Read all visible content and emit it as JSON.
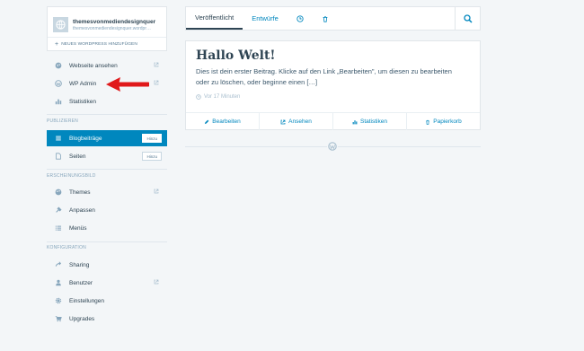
{
  "site": {
    "title": "themesvonmediendesignquer",
    "url": "themesvonmediendesignquer.wordpr…",
    "add_label": "NEUES WORDPRESS HINZUFÜGEN"
  },
  "sidebar": {
    "top_items": [
      {
        "label": "Webseite ansehen",
        "icon": "globe-icon",
        "external": true
      },
      {
        "label": "WP Admin",
        "icon": "wordpress-icon",
        "external": true
      },
      {
        "label": "Statistiken",
        "icon": "stats-icon",
        "external": false
      }
    ],
    "sections": [
      {
        "label": "PUBLIZIEREN",
        "items": [
          {
            "label": "Blogbeiträge",
            "icon": "posts-icon",
            "active": true,
            "add": "Hinzu"
          },
          {
            "label": "Seiten",
            "icon": "pages-icon",
            "active": false,
            "add": "Hinzu"
          }
        ]
      },
      {
        "label": "ERSCHEINUNGSBILD",
        "items": [
          {
            "label": "Themes",
            "icon": "themes-icon",
            "external": true
          },
          {
            "label": "Anpassen",
            "icon": "customize-icon"
          },
          {
            "label": "Menüs",
            "icon": "menus-icon"
          }
        ]
      },
      {
        "label": "KONFIGURATION",
        "items": [
          {
            "label": "Sharing",
            "icon": "share-icon"
          },
          {
            "label": "Benutzer",
            "icon": "user-icon",
            "external": true
          },
          {
            "label": "Einstellungen",
            "icon": "gear-icon"
          },
          {
            "label": "Upgrades",
            "icon": "cart-icon"
          }
        ]
      }
    ]
  },
  "tabs": {
    "published": "Veröffentlicht",
    "drafts": "Entwürfe",
    "scheduled_icon": "clock-icon",
    "trash_icon": "trash-icon",
    "search_icon": "search-icon"
  },
  "post": {
    "title": "Hallo Welt!",
    "excerpt": "Dies ist dein erster Beitrag. Klicke auf den Link „Bearbeiten\", um diesen zu bearbeiten oder zu löschen, oder beginne einen […]",
    "time": "Vor 17 Minuten",
    "actions": {
      "edit": "Bearbeiten",
      "view": "Ansehen",
      "stats": "Statistiken",
      "trash": "Papierkorb"
    }
  },
  "colors": {
    "accent": "#0087be",
    "text": "#2e4453",
    "muted": "#87a6bc",
    "background": "#f3f6f8",
    "annotation_arrow": "#e0191b"
  }
}
